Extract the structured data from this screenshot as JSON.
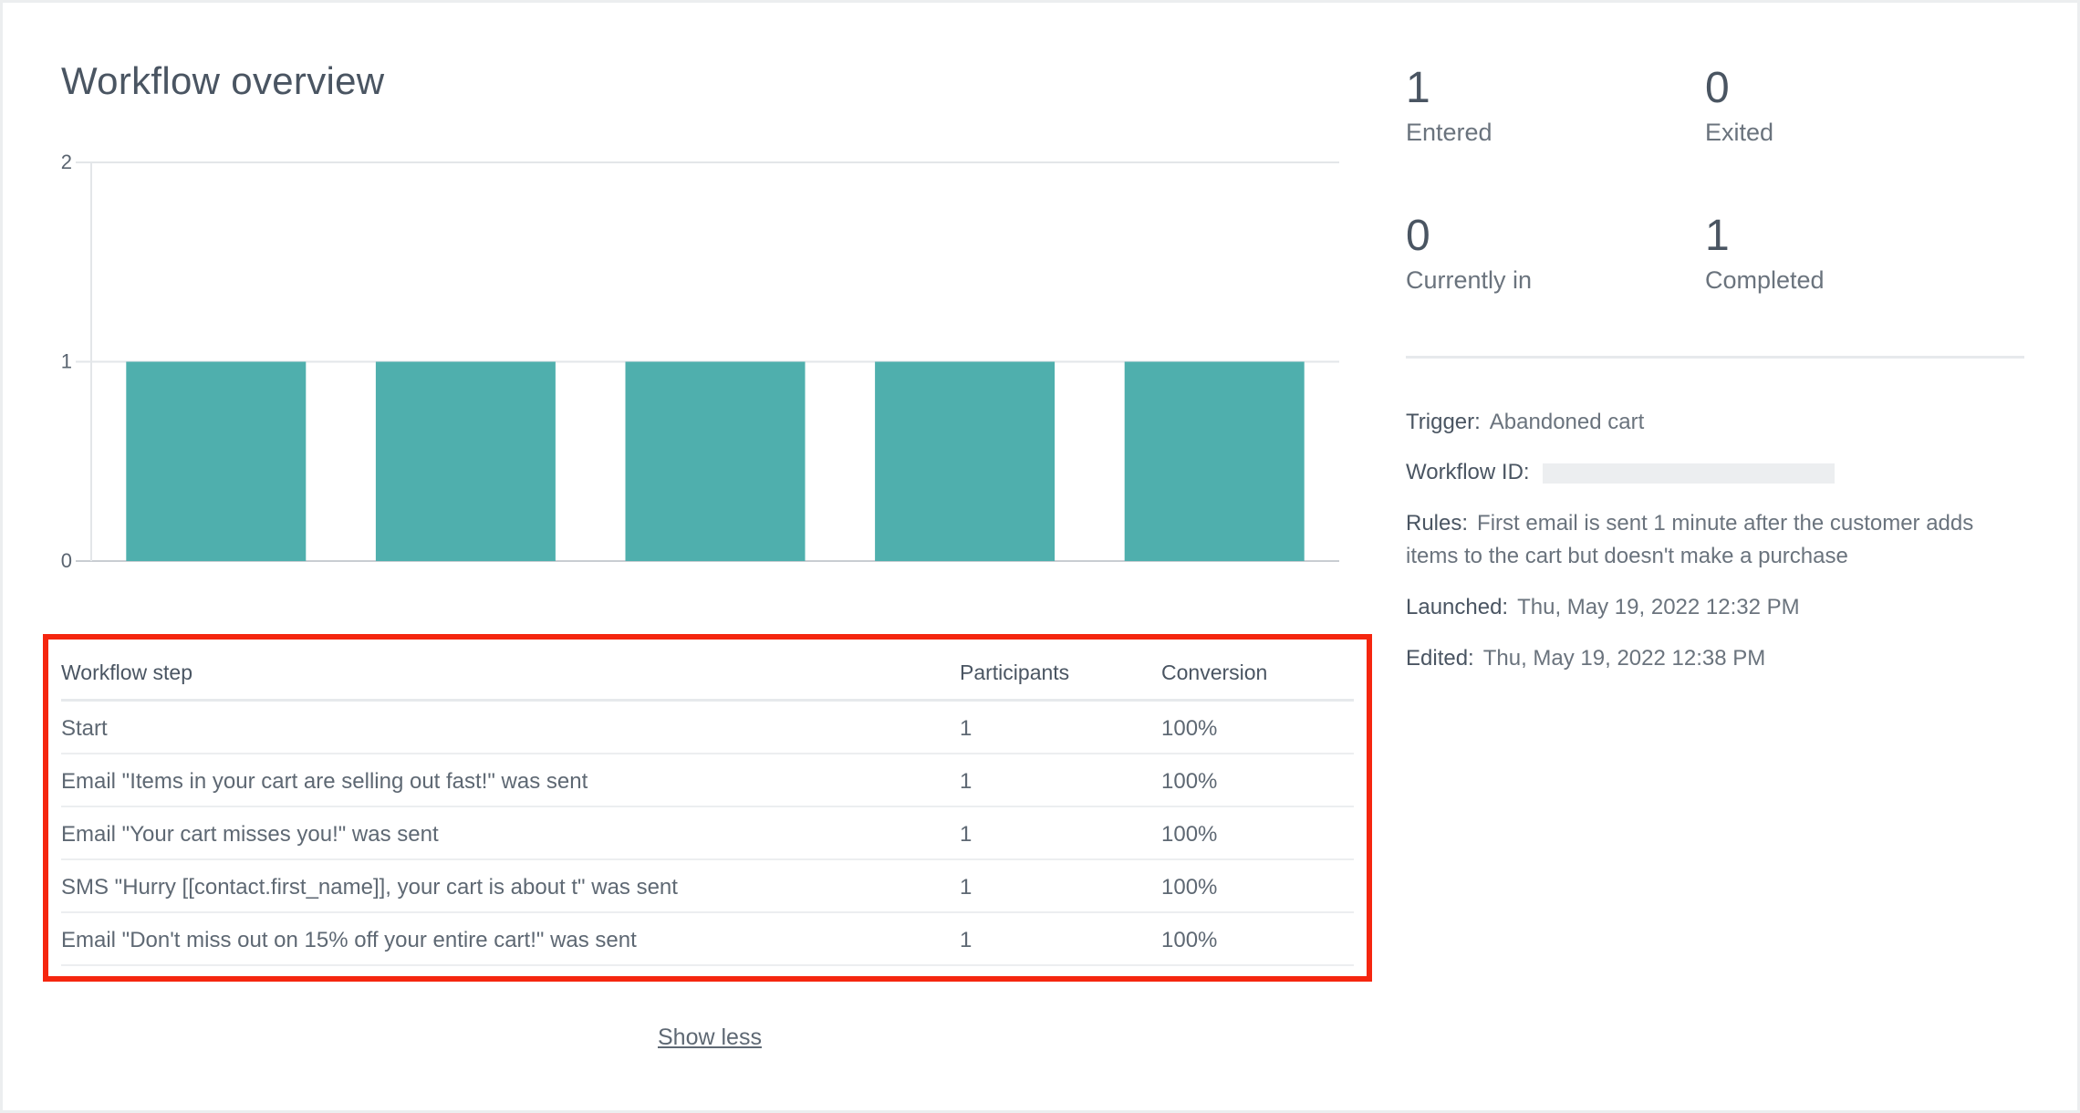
{
  "overview": {
    "title": "Workflow overview"
  },
  "chart_data": {
    "type": "bar",
    "categories": [
      "Start",
      "Email \"Items in your cart are selling out fast!\" was sent",
      "Email \"Your cart misses you!\" was sent",
      "SMS \"Hurry [[contact.first_name]], your cart is about t\" was sent",
      "Email \"Don't miss out on 15% off your entire cart!\" was sent"
    ],
    "values": [
      1,
      1,
      1,
      1,
      1
    ],
    "ylim": [
      0,
      2
    ],
    "yticks": [
      "0",
      "1",
      "2"
    ],
    "grid": true,
    "bar_color": "#4fafad",
    "title": "",
    "xlabel": "",
    "ylabel": ""
  },
  "table": {
    "headers": {
      "step": "Workflow step",
      "participants": "Participants",
      "conversion": "Conversion"
    },
    "rows": [
      {
        "step": "Start",
        "participants": "1",
        "conversion": "100%"
      },
      {
        "step": "Email \"Items in your cart are selling out fast!\" was sent",
        "participants": "1",
        "conversion": "100%"
      },
      {
        "step": "Email \"Your cart misses you!\" was sent",
        "participants": "1",
        "conversion": "100%"
      },
      {
        "step": "SMS \"Hurry [[contact.first_name]], your cart is about t\" was sent",
        "participants": "1",
        "conversion": "100%"
      },
      {
        "step": "Email \"Don't miss out on 15% off your entire cart!\" was sent",
        "participants": "1",
        "conversion": "100%"
      }
    ],
    "highlight_color": "#f5260f"
  },
  "show_less": "Show less",
  "stats": {
    "entered": {
      "value": "1",
      "label": "Entered"
    },
    "exited": {
      "value": "0",
      "label": "Exited"
    },
    "currently_in": {
      "value": "0",
      "label": "Currently in"
    },
    "completed": {
      "value": "1",
      "label": "Completed"
    }
  },
  "details": {
    "trigger_label": "Trigger:",
    "trigger_value": "Abandoned cart",
    "workflow_id_label": "Workflow ID:",
    "rules_label": "Rules:",
    "rules_value": "First email is sent 1 minute after the customer adds items to the cart but doesn't make a purchase",
    "launched_label": "Launched:",
    "launched_value": "Thu, May 19, 2022 12:32 PM",
    "edited_label": "Edited:",
    "edited_value": "Thu, May 19, 2022 12:38 PM"
  }
}
